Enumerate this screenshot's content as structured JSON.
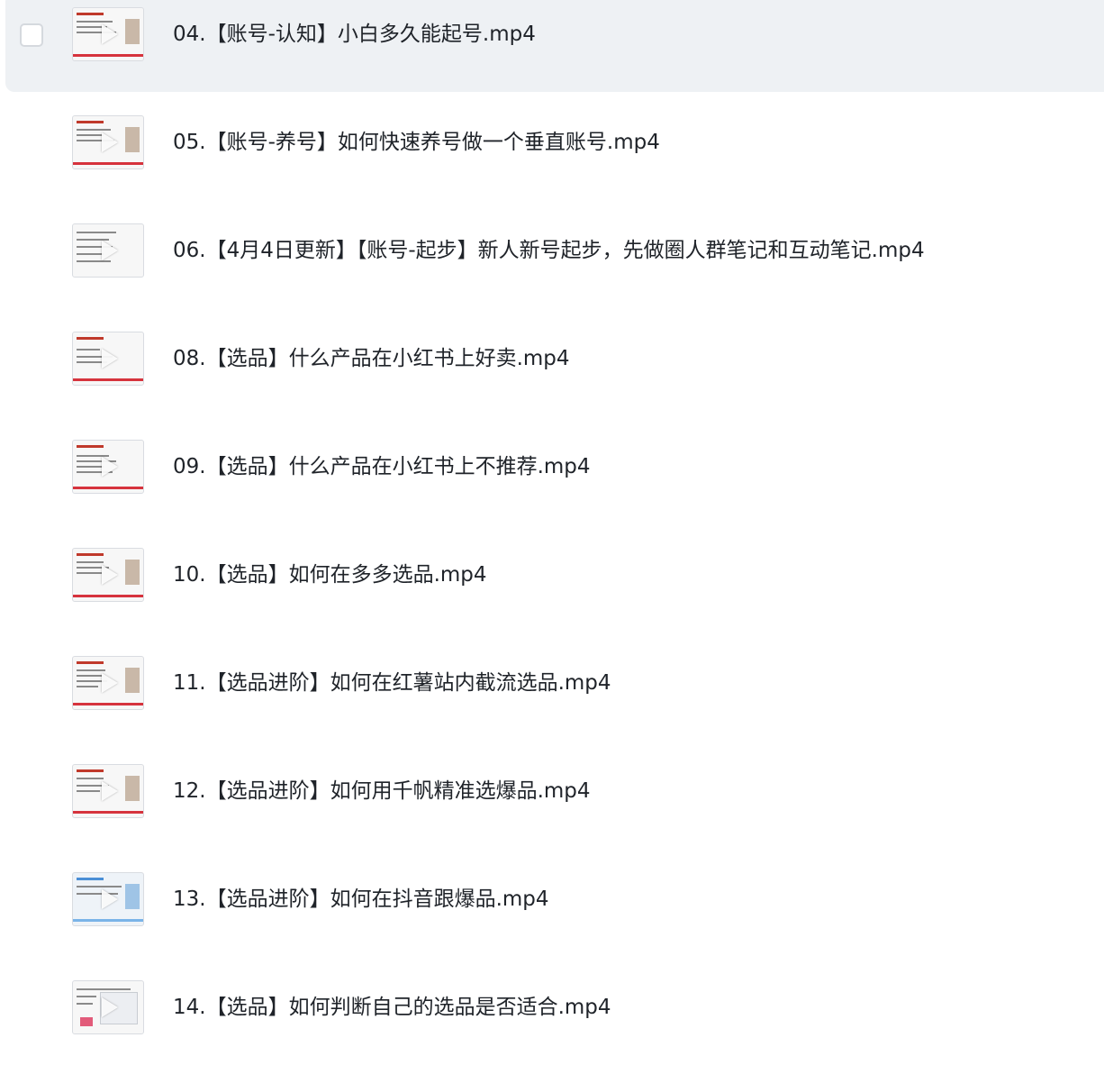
{
  "files": [
    {
      "name": "04.【账号-认知】小白多久能起号.mp4",
      "thumbnail_style": "red"
    },
    {
      "name": "05.【账号-养号】如何快速养号做一个垂直账号.mp4",
      "thumbnail_style": "red"
    },
    {
      "name": "06.【4月4日更新】【账号-起步】新人新号起步，先做圈人群笔记和互动笔记.mp4",
      "thumbnail_style": "grey"
    },
    {
      "name": "08.【选品】什么产品在小红书上好卖.mp4",
      "thumbnail_style": "red"
    },
    {
      "name": "09.【选品】什么产品在小红书上不推荐.mp4",
      "thumbnail_style": "red"
    },
    {
      "name": "10.【选品】如何在多多选品.mp4",
      "thumbnail_style": "red"
    },
    {
      "name": "11.【选品进阶】如何在红薯站内截流选品.mp4",
      "thumbnail_style": "red"
    },
    {
      "name": "12.【选品进阶】如何用千帆精准选爆品.mp4",
      "thumbnail_style": "red"
    },
    {
      "name": "13.【选品进阶】如何在抖音跟爆品.mp4",
      "thumbnail_style": "blue"
    },
    {
      "name": "14.【选品】如何判断自己的选品是否适合.mp4",
      "thumbnail_style": "table"
    }
  ],
  "hovered_index": 0,
  "colors": {
    "hover_background": "#eef1f4",
    "text": "#1f2329",
    "accent_red": "#d6333d"
  },
  "icons": {
    "checkbox": "checkbox-icon",
    "play": "play-icon"
  }
}
